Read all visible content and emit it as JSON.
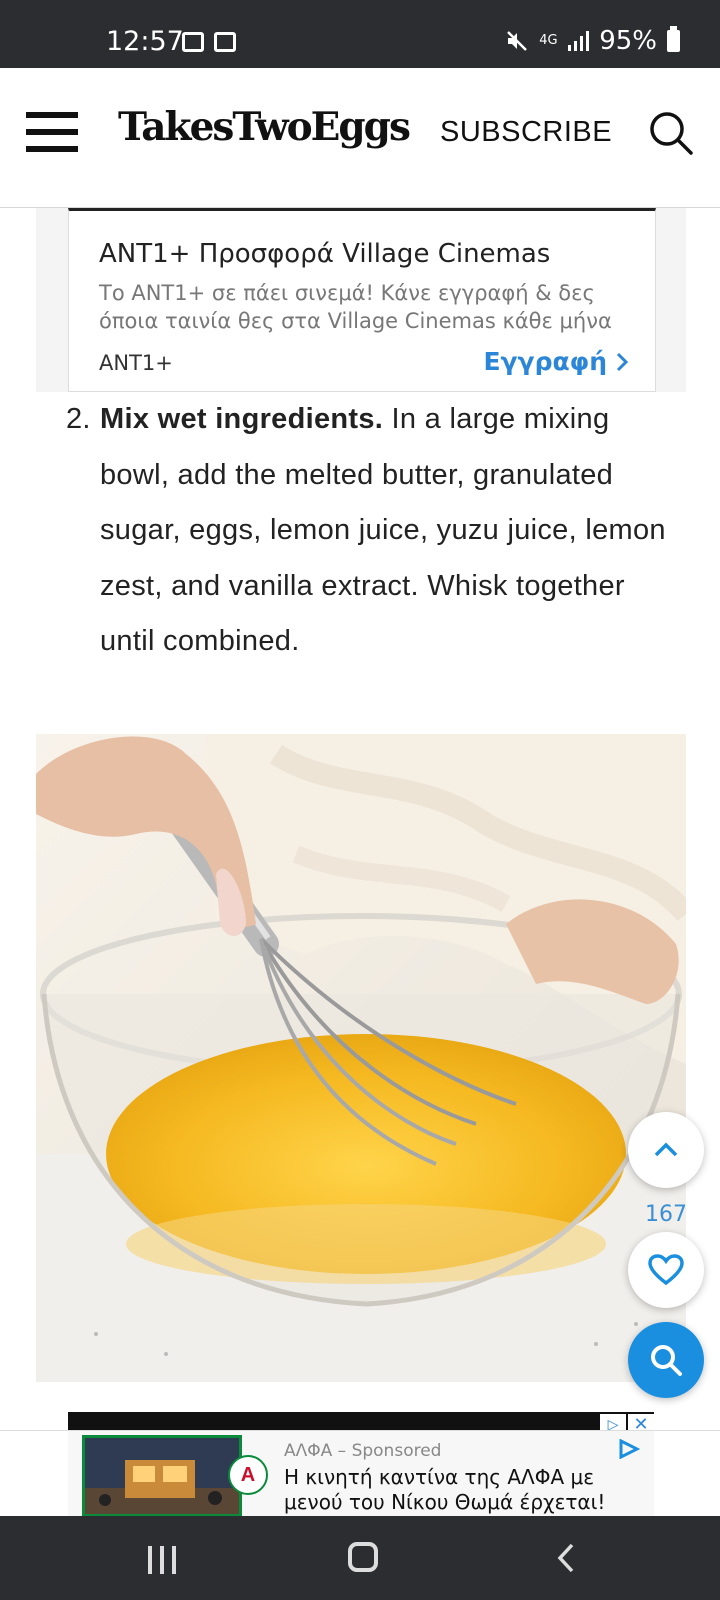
{
  "status_bar": {
    "time": "12:57",
    "network": "4G",
    "battery": "95%"
  },
  "header": {
    "logo": "TakesTwoEggs",
    "subscribe_label": "SUBSCRIBE"
  },
  "top_ad": {
    "title": "ANT1+ Προσφορά Village Cinemas",
    "description": "Το ANT1+ σε πάει σινεμά! Κάνε εγγραφή & δες όποια ταινία θες στα Village Cinemas κάθε μήνα",
    "advertiser": "ANT1+",
    "cta_label": "Εγγραφή"
  },
  "step": {
    "number": "2.",
    "heading": "Mix wet ingredients.",
    "text": " In a large mixing bowl, add the melted butter, granulated sugar, eggs, lemon juice, yuzu juice, lemon zest, and vanilla extract. Whisk together until combined."
  },
  "floating": {
    "favorite_count": "167"
  },
  "bottom_ad": {
    "sponsor_line": "ΑΛΦΑ – Sponsored",
    "text": "Η κινητή καντίνα της ΑΛΦΑ με μενού του Νίκου Θωμά έρχεται!",
    "logo_letter": "A"
  },
  "colors": {
    "status_bar_bg": "#2c2d31",
    "link_blue": "#2b86d8",
    "fab_blue": "#1a8fe0"
  }
}
